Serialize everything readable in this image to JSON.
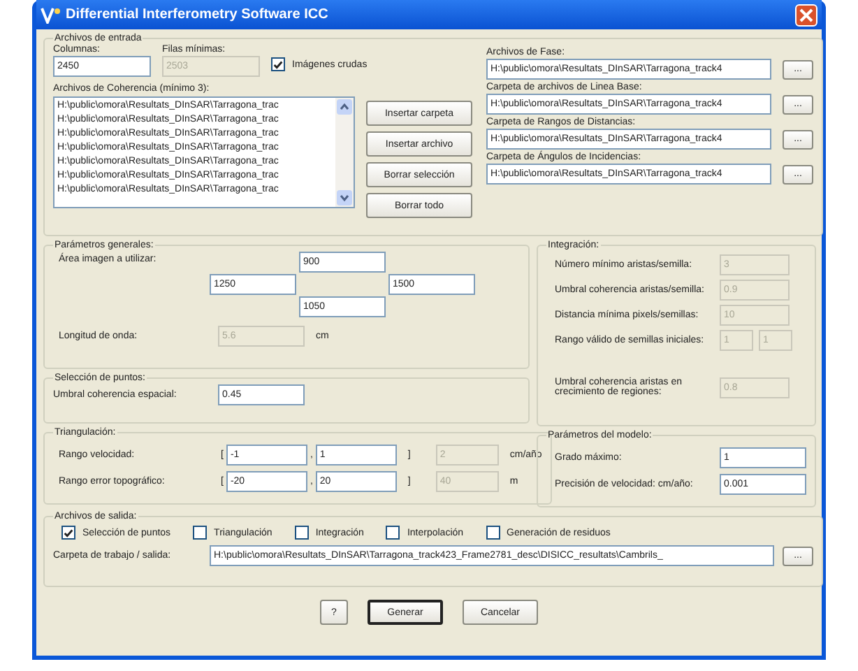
{
  "window": {
    "title": "Differential Interferometry Software ICC"
  },
  "input_files": {
    "title": "Archivos de entrada",
    "columns": {
      "label": "Columnas:",
      "value": "2450",
      "disabled": false
    },
    "min_rows": {
      "label": "Filas mínimas:",
      "value": "2503",
      "disabled": true
    },
    "raw_images": {
      "label": "Imágenes crudas",
      "checked": true
    },
    "coherence": {
      "label": "Archivos de Coherencia (mínimo 3):",
      "items": [
        {
          "text": "H:\\public\\omora\\Resultats_DInSAR\\Tarragona_trac",
          "selected": false
        },
        {
          "text": "H:\\public\\omora\\Resultats_DInSAR\\Tarragona_trac",
          "selected": false
        },
        {
          "text": "H:\\public\\omora\\Resultats_DInSAR\\Tarragona_trac",
          "selected": false
        },
        {
          "text": "H:\\public\\omora\\Resultats_DInSAR\\Tarragona_trac",
          "selected": false
        },
        {
          "text": "H:\\public\\omora\\Resultats_DInSAR\\Tarragona_trac",
          "selected": false
        },
        {
          "text": "H:\\public\\omora\\Resultats_DInSAR\\Tarragona_trac",
          "selected": false
        },
        {
          "text": "H:\\public\\omora\\Resultats_DInSAR\\Tarragona_trac",
          "selected": false
        }
      ]
    },
    "buttons": [
      "Insertar carpeta",
      "Insertar archivo",
      "Borrar selección",
      "Borrar todo"
    ],
    "paths": [
      {
        "label": "Archivos de Fase:",
        "value": "H:\\public\\omora\\Resultats_DInSAR\\Tarragona_track4",
        "button": "..."
      },
      {
        "label": "Carpeta de archivos de Linea Base:",
        "value": "H:\\public\\omora\\Resultats_DInSAR\\Tarragona_track4",
        "button": "..."
      },
      {
        "label": "Carpeta de Rangos de Distancias:",
        "value": "H:\\public\\omora\\Resultats_DInSAR\\Tarragona_track4",
        "button": "..."
      },
      {
        "label": "Carpeta de Ángulos de Incidencias:",
        "value": "H:\\public\\omora\\Resultats_DInSAR\\Tarragona_track4",
        "button": "..."
      }
    ]
  },
  "general": {
    "title": "Parámetros generales:",
    "area_label": "Área imagen a utilizar:",
    "area": {
      "top": {
        "value": "900",
        "disabled": false
      },
      "left": {
        "value": "1250",
        "disabled": false
      },
      "right": {
        "value": "1500",
        "disabled": false
      },
      "bottom": {
        "value": "1050",
        "disabled": false
      }
    },
    "wavelength": {
      "label": "Longitud de onda:",
      "value": "5.6",
      "disabled": true,
      "unit": "cm"
    }
  },
  "points": {
    "title": "Selección de puntos:",
    "label": "Umbral coherencia espacial:",
    "value": "0.45",
    "disabled": false
  },
  "triangulation": {
    "title": "Triangulación:",
    "rows": [
      {
        "label": "Rango velocidad:",
        "open": "[",
        "from": {
          "value": "-1",
          "disabled": false
        },
        "sep": ",",
        "to": {
          "value": "1",
          "disabled": false
        },
        "close": "]",
        "extra": {
          "value": "2",
          "disabled": true
        },
        "unit": "cm/año"
      },
      {
        "label": "Rango error topográfico:",
        "open": "[",
        "from": {
          "value": "-20",
          "disabled": false
        },
        "sep": ",",
        "to": {
          "value": "20",
          "disabled": false
        },
        "close": "]",
        "extra": {
          "value": "40",
          "disabled": true
        },
        "unit": "m"
      }
    ]
  },
  "integration": {
    "title": "Integración:",
    "rows": [
      {
        "label": "Número mínimo aristas/semilla:",
        "fields": [
          {
            "value": "3",
            "disabled": true
          }
        ]
      },
      {
        "label": "Umbral coherencia aristas/semilla:",
        "fields": [
          {
            "value": "0.9",
            "disabled": true
          }
        ]
      },
      {
        "label": "Distancia mínima pixels/semillas:",
        "fields": [
          {
            "value": "10",
            "disabled": true
          }
        ]
      },
      {
        "label": "Rango válido de semillas iniciales:",
        "fields": [
          {
            "value": "1",
            "disabled": true
          },
          {
            "value": "1",
            "disabled": true
          }
        ]
      },
      {
        "label": "Umbral coherencia aristas en crecimiento de regiones:",
        "fields": [
          {
            "value": "0.8",
            "disabled": true
          }
        ]
      }
    ]
  },
  "model": {
    "title": "Parámetros del modelo:",
    "rows": [
      {
        "label": "Grado máximo:",
        "value": "1",
        "disabled": false
      },
      {
        "label": "Precisión de velocidad: cm/año:",
        "value": "0.001",
        "disabled": false
      }
    ]
  },
  "output": {
    "title": "Archivos de salida:",
    "options": [
      {
        "label": "Selección de puntos",
        "checked": true
      },
      {
        "label": "Triangulación",
        "checked": false
      },
      {
        "label": "Integración",
        "checked": false
      },
      {
        "label": "Interpolación",
        "checked": false
      },
      {
        "label": "Generación de residuos",
        "checked": false
      }
    ],
    "folder": {
      "label": "Carpeta de trabajo / salida:",
      "value": "H:\\public\\omora\\Resultats_DInSAR\\Tarragona_track423_Frame2781_desc\\DISICC_resultats\\Cambrils_",
      "button": "..."
    }
  },
  "buttons": [
    {
      "label": "?",
      "default": false
    },
    {
      "label": "Generar",
      "default": true
    },
    {
      "label": "Cancelar",
      "default": false
    }
  ]
}
